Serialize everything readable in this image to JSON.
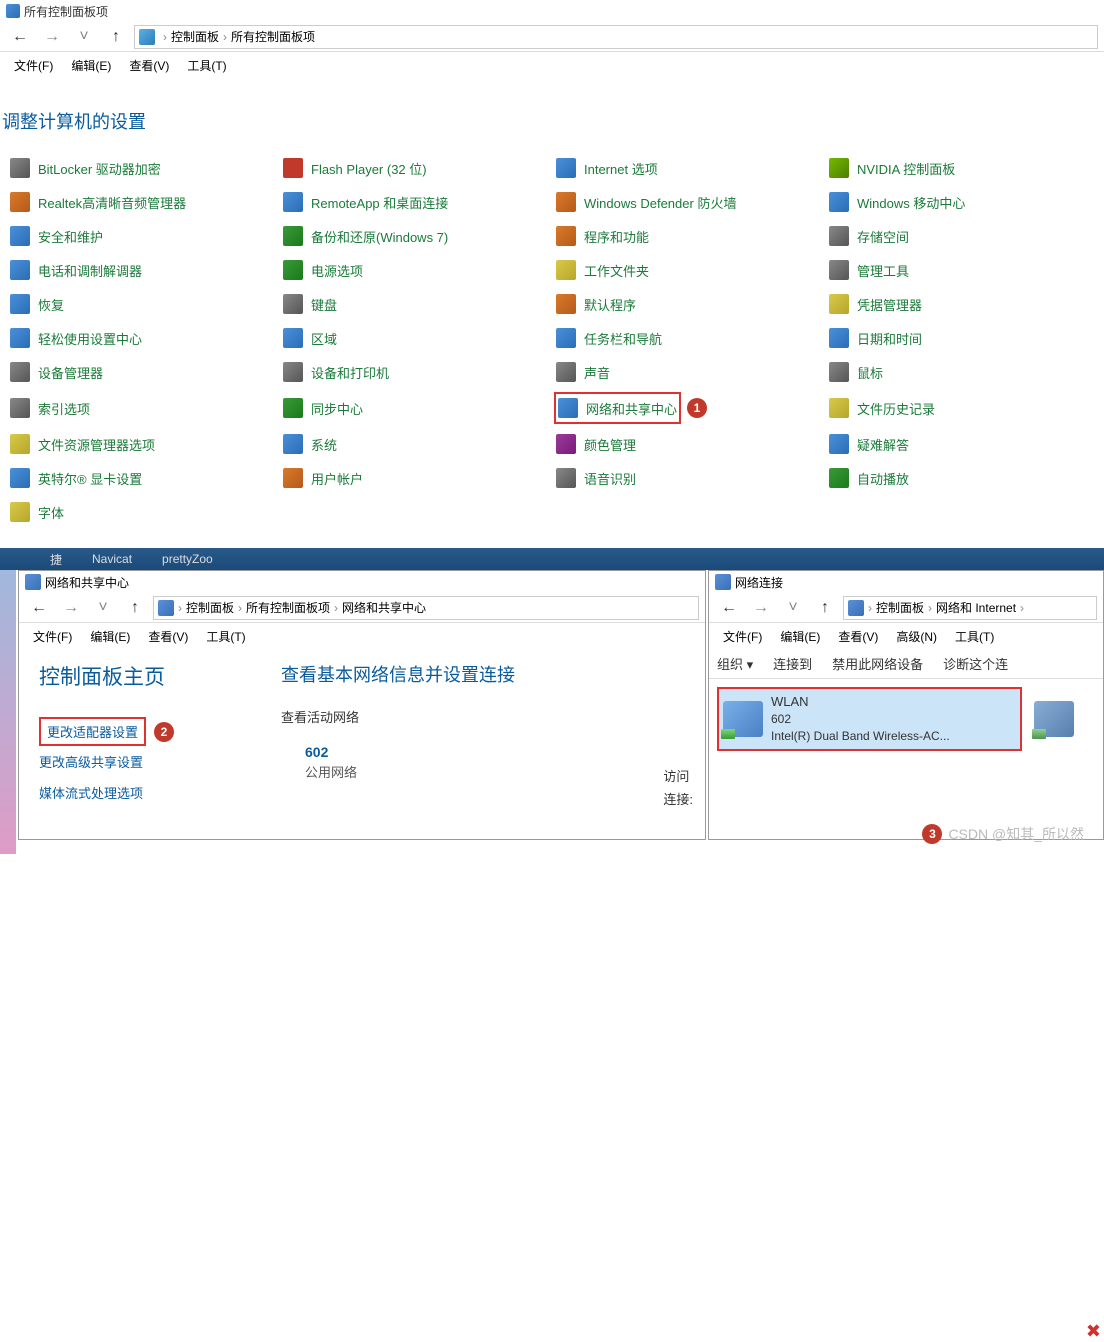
{
  "window1": {
    "title": "所有控制面板项",
    "breadcrumb": [
      "控制面板",
      "所有控制面板项"
    ],
    "menu": [
      "文件(F)",
      "编辑(E)",
      "查看(V)",
      "工具(T)"
    ],
    "heading": "调整计算机的设置",
    "items": [
      {
        "label": "BitLocker 驱动器加密",
        "icon": "ic-a"
      },
      {
        "label": "Flash Player (32 位)",
        "icon": "ic-g"
      },
      {
        "label": "Internet 选项",
        "icon": "ic-b"
      },
      {
        "label": "NVIDIA 控制面板",
        "icon": "ic-h"
      },
      {
        "label": "Realtek高清晰音频管理器",
        "icon": "ic-d"
      },
      {
        "label": "RemoteApp 和桌面连接",
        "icon": "ic-b"
      },
      {
        "label": "Windows Defender 防火墙",
        "icon": "ic-d"
      },
      {
        "label": "Windows 移动中心",
        "icon": "ic-b"
      },
      {
        "label": "安全和维护",
        "icon": "ic-b"
      },
      {
        "label": "备份和还原(Windows 7)",
        "icon": "ic-c"
      },
      {
        "label": "程序和功能",
        "icon": "ic-d"
      },
      {
        "label": "存储空间",
        "icon": "ic-a"
      },
      {
        "label": "电话和调制解调器",
        "icon": "ic-b"
      },
      {
        "label": "电源选项",
        "icon": "ic-c"
      },
      {
        "label": "工作文件夹",
        "icon": "ic-f"
      },
      {
        "label": "管理工具",
        "icon": "ic-a"
      },
      {
        "label": "恢复",
        "icon": "ic-b"
      },
      {
        "label": "键盘",
        "icon": "ic-a"
      },
      {
        "label": "默认程序",
        "icon": "ic-d"
      },
      {
        "label": "凭据管理器",
        "icon": "ic-f"
      },
      {
        "label": "轻松使用设置中心",
        "icon": "ic-b"
      },
      {
        "label": "区域",
        "icon": "ic-b"
      },
      {
        "label": "任务栏和导航",
        "icon": "ic-b"
      },
      {
        "label": "日期和时间",
        "icon": "ic-b"
      },
      {
        "label": "设备管理器",
        "icon": "ic-a"
      },
      {
        "label": "设备和打印机",
        "icon": "ic-a"
      },
      {
        "label": "声音",
        "icon": "ic-a"
      },
      {
        "label": "鼠标",
        "icon": "ic-a"
      },
      {
        "label": "索引选项",
        "icon": "ic-a"
      },
      {
        "label": "同步中心",
        "icon": "ic-c"
      },
      {
        "label": "网络和共享中心",
        "icon": "ic-b",
        "highlight": true,
        "badge": "1"
      },
      {
        "label": "文件历史记录",
        "icon": "ic-f"
      },
      {
        "label": "文件资源管理器选项",
        "icon": "ic-f"
      },
      {
        "label": "系统",
        "icon": "ic-b"
      },
      {
        "label": "颜色管理",
        "icon": "ic-e"
      },
      {
        "label": "疑难解答",
        "icon": "ic-b"
      },
      {
        "label": "英特尔® 显卡设置",
        "icon": "ic-b"
      },
      {
        "label": "用户帐户",
        "icon": "ic-d"
      },
      {
        "label": "语音识别",
        "icon": "ic-a"
      },
      {
        "label": "自动播放",
        "icon": "ic-c"
      },
      {
        "label": "字体",
        "icon": "ic-f"
      }
    ]
  },
  "taskbar": {
    "items": [
      "捷",
      "Navicat",
      "prettyZoo"
    ]
  },
  "window2": {
    "title": "网络和共享中心",
    "breadcrumb": [
      "控制面板",
      "所有控制面板项",
      "网络和共享中心"
    ],
    "menu": [
      "文件(F)",
      "编辑(E)",
      "查看(V)",
      "工具(T)"
    ],
    "sidebar_heading": "控制面板主页",
    "sidebar_links": [
      {
        "label": "更改适配器设置",
        "highlight": true,
        "badge": "2"
      },
      {
        "label": "更改高级共享设置"
      },
      {
        "label": "媒体流式处理选项"
      }
    ],
    "main_title": "查看基本网络信息并设置连接",
    "section_label": "查看活动网络",
    "network_name": "602",
    "network_type": "公用网络",
    "right_labels": [
      "访问",
      "连接:"
    ]
  },
  "window3": {
    "title": "网络连接",
    "breadcrumb": [
      "控制面板",
      "网络和 Internet"
    ],
    "menu": [
      "文件(F)",
      "编辑(E)",
      "查看(V)",
      "高级(N)",
      "工具(T)"
    ],
    "toolbar": [
      "组织 ▾",
      "连接到",
      "禁用此网络设备",
      "诊断这个连"
    ],
    "connections": [
      {
        "name": "WLAN",
        "ssid": "602",
        "adapter": "Intel(R) Dual Band Wireless-AC...",
        "highlight": true,
        "badge": "3"
      }
    ]
  },
  "watermark": "CSDN @知其_所以然"
}
